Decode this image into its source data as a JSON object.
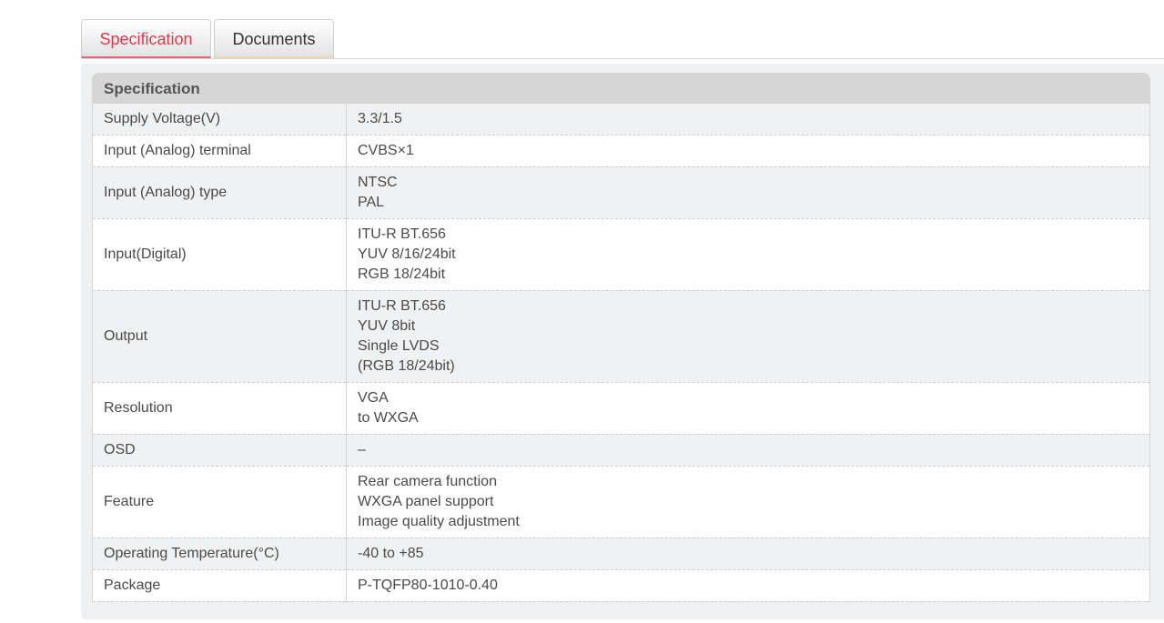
{
  "tabs": [
    {
      "label": "Specification",
      "active": true
    },
    {
      "label": "Documents",
      "active": false
    }
  ],
  "spec": {
    "header": "Specification",
    "rows": [
      {
        "label": "Supply Voltage(V)",
        "values": [
          "3.3/1.5"
        ]
      },
      {
        "label": "Input (Analog) terminal",
        "values": [
          "CVBS×1"
        ]
      },
      {
        "label": "Input (Analog) type",
        "values": [
          "NTSC",
          "PAL"
        ]
      },
      {
        "label": "Input(Digital)",
        "values": [
          "ITU-R BT.656",
          "YUV 8/16/24bit",
          "RGB 18/24bit"
        ]
      },
      {
        "label": "Output",
        "values": [
          "ITU-R BT.656",
          "YUV 8bit",
          "Single LVDS",
          "(RGB 18/24bit)"
        ]
      },
      {
        "label": "Resolution",
        "values": [
          "VGA",
          "to WXGA"
        ]
      },
      {
        "label": "OSD",
        "values": [
          "–"
        ]
      },
      {
        "label": "Feature",
        "values": [
          "Rear camera function",
          "WXGA panel support",
          "Image quality adjustment"
        ]
      },
      {
        "label": "Operating Temperature(°C)",
        "values": [
          "-40 to +85"
        ]
      },
      {
        "label": "Package",
        "values": [
          "P-TQFP80-1010-0.40"
        ]
      }
    ]
  },
  "colors": {
    "active_tab_text": "#e4354f",
    "active_tab_underline": "#e8627a",
    "inactive_tab_underline": "#f3d9a3",
    "header_bg": "#d6d6d6",
    "odd_row_bg": "#f0f1f2",
    "even_row_bg": "#ffffff"
  }
}
